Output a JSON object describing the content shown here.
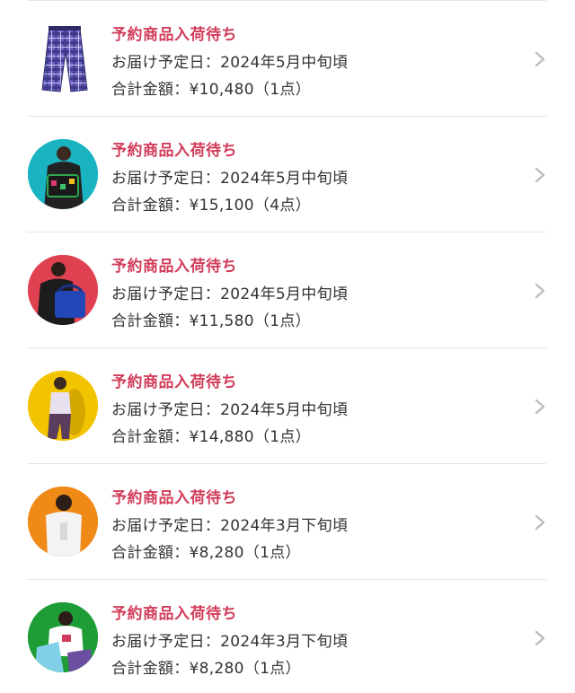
{
  "orders": [
    {
      "status": "予約商品入荷待ち",
      "delivery": "お届け予定日：2024年5月中旬頃",
      "total": "合計金額：¥10,480（1点）",
      "thumb_icon": "plaid-pants-image",
      "thumb_bg": "#ffffff",
      "accent": "#6a5fc0"
    },
    {
      "status": "予約商品入荷待ち",
      "delivery": "お届け予定日：2024年5月中旬頃",
      "total": "合計金額：¥15,100（4点）",
      "thumb_icon": "model-photo",
      "thumb_bg": "#19b3c2",
      "accent": "#222222"
    },
    {
      "status": "予約商品入荷待ち",
      "delivery": "お届け予定日：2024年5月中旬頃",
      "total": "合計金額：¥11,580（1点）",
      "thumb_icon": "model-photo",
      "thumb_bg": "#e04150",
      "accent": "#2447b8"
    },
    {
      "status": "予約商品入荷待ち",
      "delivery": "お届け予定日：2024年5月中旬頃",
      "total": "合計金額：¥14,880（1点）",
      "thumb_icon": "model-photo",
      "thumb_bg": "#f2c400",
      "accent": "#5a3d5c"
    },
    {
      "status": "予約商品入荷待ち",
      "delivery": "お届け予定日：2024年3月下旬頃",
      "total": "合計金額：¥8,280（1点）",
      "thumb_icon": "model-photo",
      "thumb_bg": "#f08a16",
      "accent": "#f3f3f3"
    },
    {
      "status": "予約商品入荷待ち",
      "delivery": "お届け予定日：2024年3月下旬頃",
      "total": "合計金額：¥8,280（1点）",
      "thumb_icon": "model-photo",
      "thumb_bg": "#1e9c36",
      "accent": "#7fd0e8"
    }
  ],
  "colors": {
    "status_text": "#d23c5a",
    "body_text": "#333333",
    "divider": "#e6e6e6",
    "chevron": "#bdbdbd"
  }
}
